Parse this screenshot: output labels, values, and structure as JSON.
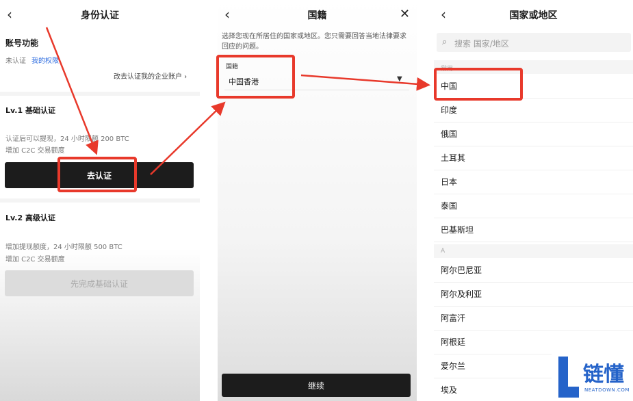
{
  "panel1": {
    "title": "身份认证",
    "account_label": "账号功能",
    "status": "未认证",
    "rights_link": "我的权限",
    "enterprise_link": "改去认证我的企业账户 ›",
    "lv1": {
      "title": "Lv.1 基础认证",
      "desc1": "认证后可以提现，24 小时限额 200 BTC",
      "desc2": "增加 C2C 交易额度",
      "button": "去认证"
    },
    "lv2": {
      "title": "Lv.2 高级认证",
      "desc1": "增加提现额度，24 小时限额 500 BTC",
      "desc2": "增加 C2C 交易额度",
      "button": "先完成基础认证"
    }
  },
  "panel2": {
    "title": "国籍",
    "intro": "选择您现在所居住的国家或地区。您只需要回答当地法律要求回应的问题。",
    "field_label": "国籍",
    "field_value": "中国香港",
    "continue": "继续"
  },
  "panel3": {
    "title": "国家或地区",
    "search_placeholder": "搜索 国家/地区",
    "section_common": "常用",
    "common": [
      "中国",
      "印度",
      "俄国",
      "土耳其",
      "日本",
      "泰国",
      "巴基斯坦"
    ],
    "section_a": "A",
    "a_list": [
      "阿尔巴尼亚",
      "阿尔及利亚",
      "阿富汗",
      "阿根廷",
      "爱尔兰",
      "埃及"
    ]
  },
  "watermark": {
    "text": "链懂",
    "sub": "NEATDOWN.COM"
  },
  "colors": {
    "highlight": "#e8392b",
    "link": "#2e6de0",
    "button_dark": "#1c1c1c"
  }
}
